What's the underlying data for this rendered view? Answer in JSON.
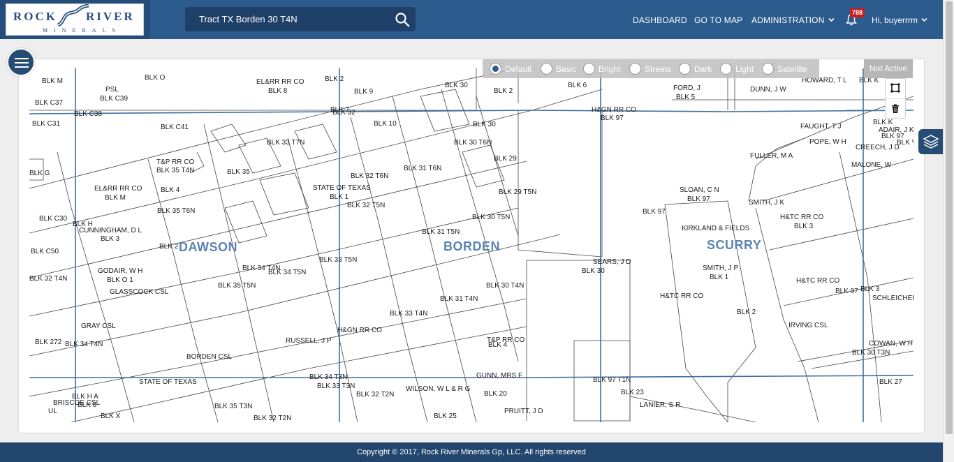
{
  "header": {
    "logo": {
      "word1": "ROCK",
      "word2": "RIVER",
      "word3": "MINERALS"
    },
    "search": {
      "value": "Tract  TX Borden 30 T4N"
    },
    "nav": {
      "dashboard": "DASHBOARD",
      "go_to_map": "GO TO MAP",
      "administration": "ADMINISTRATION"
    },
    "notifications": {
      "count": "788"
    },
    "user": {
      "greeting": "Hi, buyerrrm"
    }
  },
  "map_controls": {
    "basemaps": [
      {
        "label": "Default",
        "selected": true
      },
      {
        "label": "Basic",
        "selected": false
      },
      {
        "label": "Bright",
        "selected": false
      },
      {
        "label": "Streets",
        "selected": false
      },
      {
        "label": "Dark",
        "selected": false
      },
      {
        "label": "Light",
        "selected": false
      },
      {
        "label": "Satellite",
        "selected": false
      }
    ],
    "status": "Not Active",
    "icons": [
      "hamburger-menu-icon",
      "square-draw-icon",
      "trash-icon",
      "layers-icon",
      "search-icon",
      "bell-icon",
      "chevron-down-icon"
    ]
  },
  "map": {
    "counties": [
      "DAWSON",
      "BORDEN",
      "SCURRY"
    ],
    "labels": [
      "BLK M",
      "BLK O",
      "EL&RR RR CO",
      "BLK 8",
      "BLK 2",
      "BLK 9",
      "BLK 30",
      "BLK 2",
      "BLK 6",
      "FORD, J",
      "BLK 5",
      "DUNN, J W",
      "HOWARD, T L",
      "BLK K",
      "PSL",
      "BLK C39",
      "BLK C37",
      "BLK C38",
      "BLK C31",
      "BLK C41",
      "BLK 7",
      "BLK 32",
      "BLK 10",
      "BLK 30",
      "H&GN RR CO",
      "BLK 97",
      "FAUGHT, T J",
      "ADAIR, J K",
      "BLK K",
      "BLK 97",
      "CREECH, J D",
      "BLK V",
      "POPE, W H",
      "T&P RR CO",
      "BLK 35 T4N",
      "BLK 35",
      "BLK 33 T7N",
      "BLK 32 T6N",
      "BLK 31 T6N",
      "BLK 30 T6N",
      "BLK 29",
      "FULLER, M A",
      "MALONE, W",
      "BLK 4",
      "EL&RR RR CO",
      "BLK M",
      "STATE OF TEXAS",
      "BLK 1",
      "BLK 32 T5N",
      "BLK 29 T5N",
      "SLOAN, C N",
      "BLK 97",
      "SMITH, J K",
      "BLK G",
      "CUNNINGHAM, D L",
      "BLK 3",
      "BLK 35 T6N",
      "BLK 30 T5N",
      "BLK 97",
      "H&TC RR CO",
      "BLK 3",
      "KIRKLAND & FIELDS",
      "BLK C30",
      "BLK H",
      "BLK 2",
      "BLK 31 T5N",
      "BLK 35 T5N",
      "BLK 33 T5N",
      "BLK 34 T5N",
      "SEARS, J D",
      "BLK 30",
      "SMITH, J P",
      "BLK 1",
      "BLK C50",
      "GODAIR, W H",
      "BLK O 1",
      "GLASSCOCK CSL",
      "BLK 34 T4N",
      "BLK 30 T4N",
      "BLK 31 T4N",
      "H&TC RR CO",
      "BLK 97",
      "H&TC RR CO",
      "BLK 3",
      "SCHLEICHER CSL",
      "BLK 32 T4N",
      "BLK 33 T4N",
      "H&GN RR CO",
      "BLK 2",
      "IRVING CSL",
      "GRAY CSL",
      "BLK 272",
      "BLK 34 T4N",
      "RUSSELL, J P",
      "BLK 4",
      "COWAN, W H",
      "BLK 30 T3N",
      "T&P RR CO",
      "BORDEN CSL",
      "STATE OF TEXAS",
      "BLK 34 T3N",
      "BLK 33 T3N",
      "BLK 32 T2N",
      "WILSON, W L & R G",
      "GUNN, MRS F",
      "BLK 20",
      "BLK 97 T1N",
      "BLK 23",
      "BLK 27",
      "PRUITT, J D",
      "LANIER, S R",
      "BLK H A",
      "BLK 6",
      "UL",
      "BRISCOE CSL",
      "BLK X",
      "BLK 35 T3N",
      "BLK 32 T2N",
      "BLK 25"
    ]
  },
  "footer": {
    "copyright": "Copyright © 2017, Rock River Minerals Gp, LLC. All rights reserved"
  }
}
